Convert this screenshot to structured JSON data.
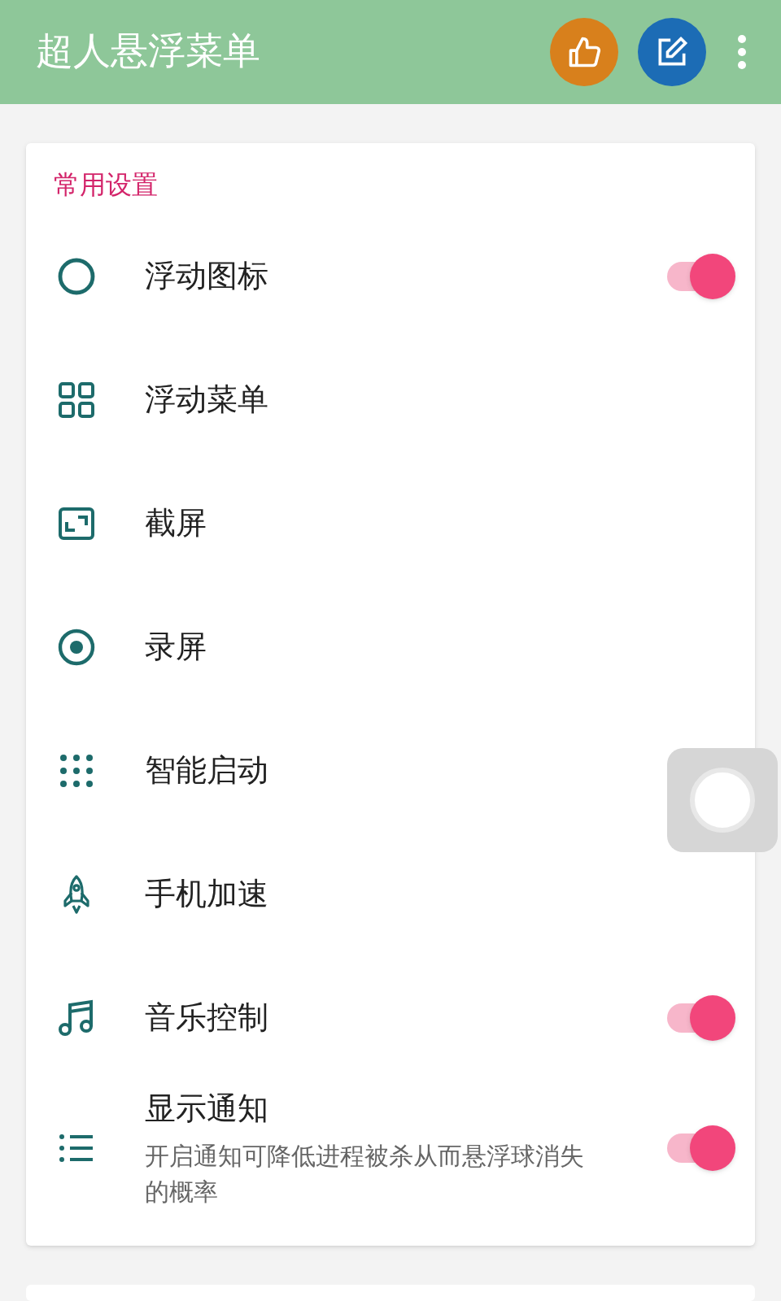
{
  "app_bar": {
    "title": "超人悬浮菜单"
  },
  "section": {
    "title": "常用设置",
    "items": [
      {
        "label": "浮动图标",
        "kind": "switch",
        "on": true
      },
      {
        "label": "浮动菜单",
        "kind": "plain"
      },
      {
        "label": "截屏",
        "kind": "plain"
      },
      {
        "label": "录屏",
        "kind": "plain"
      },
      {
        "label": "智能启动",
        "kind": "plain"
      },
      {
        "label": "手机加速",
        "kind": "plain"
      },
      {
        "label": "音乐控制",
        "kind": "switch",
        "on": true
      },
      {
        "label": "显示通知",
        "subtitle": "开启通知可降低进程被杀从而悬浮球消失的概率",
        "kind": "switch",
        "on": true
      }
    ]
  }
}
